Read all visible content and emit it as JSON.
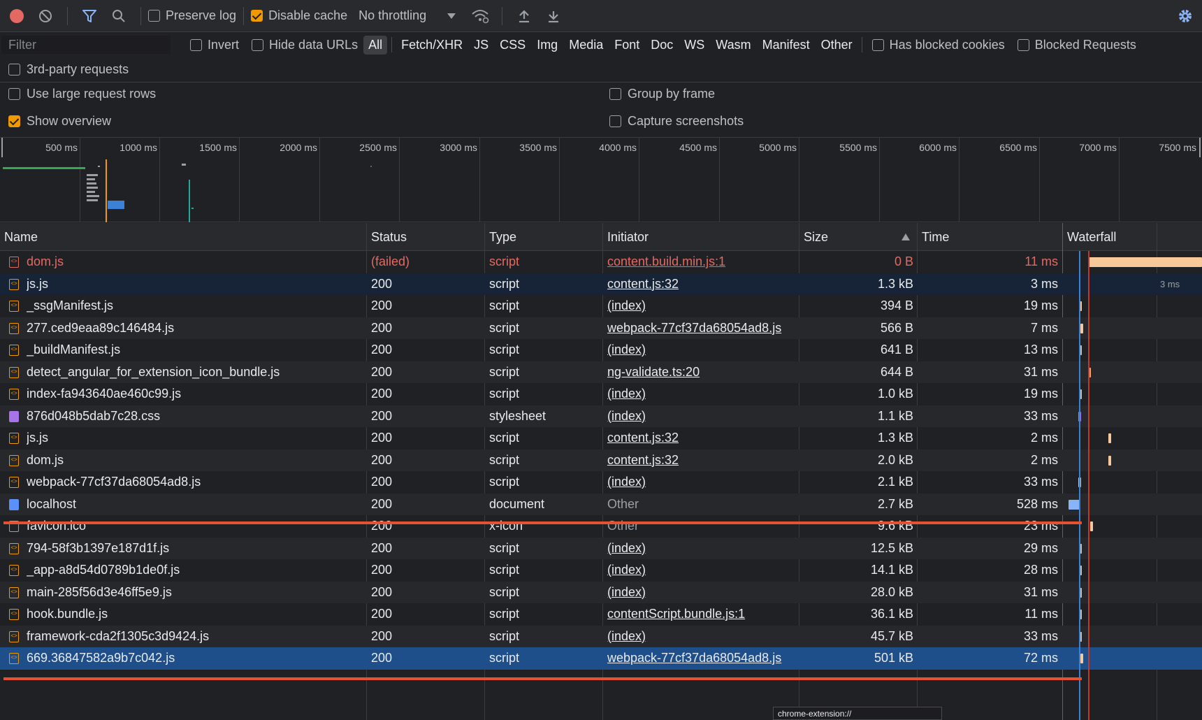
{
  "toolbar": {
    "preserve_log": "Preserve log",
    "disable_cache": "Disable cache",
    "throttling": "No throttling"
  },
  "filterbar": {
    "filter_placeholder": "Filter",
    "invert": "Invert",
    "hide_data_urls": "Hide data URLs",
    "types": [
      "All",
      "Fetch/XHR",
      "JS",
      "CSS",
      "Img",
      "Media",
      "Font",
      "Doc",
      "WS",
      "Wasm",
      "Manifest",
      "Other"
    ],
    "has_blocked_cookies": "Has blocked cookies",
    "blocked_requests": "Blocked Requests",
    "third_party": "3rd-party requests"
  },
  "settings": {
    "large_rows": "Use large request rows",
    "group_by_frame": "Group by frame",
    "show_overview": "Show overview",
    "capture_screenshots": "Capture screenshots"
  },
  "overview": {
    "ticks": [
      "500 ms",
      "1000 ms",
      "1500 ms",
      "2000 ms",
      "2500 ms",
      "3000 ms",
      "3500 ms",
      "4000 ms",
      "4500 ms",
      "5000 ms",
      "5500 ms",
      "6000 ms",
      "6500 ms",
      "7000 ms",
      "7500 ms"
    ]
  },
  "table": {
    "headers": {
      "name": "Name",
      "status": "Status",
      "type": "Type",
      "initiator": "Initiator",
      "size": "Size",
      "time": "Time",
      "waterfall": "Waterfall"
    },
    "rows": [
      {
        "name": "dom.js",
        "status": "(failed)",
        "type": "script",
        "initiator": "content.build.min.js:1",
        "size": "0 B",
        "time": "11 ms"
      },
      {
        "name": "js.js",
        "status": "200",
        "type": "script",
        "initiator": "content.js:32",
        "size": "1.3 kB",
        "time": "3 ms"
      },
      {
        "name": "_ssgManifest.js",
        "status": "200",
        "type": "script",
        "initiator": "(index)",
        "size": "394 B",
        "time": "19 ms"
      },
      {
        "name": "277.ced9eaa89c146484.js",
        "status": "200",
        "type": "script",
        "initiator": "webpack-77cf37da68054ad8.js",
        "size": "566 B",
        "time": "7 ms"
      },
      {
        "name": "_buildManifest.js",
        "status": "200",
        "type": "script",
        "initiator": "(index)",
        "size": "641 B",
        "time": "13 ms"
      },
      {
        "name": "detect_angular_for_extension_icon_bundle.js",
        "status": "200",
        "type": "script",
        "initiator": "ng-validate.ts:20",
        "size": "644 B",
        "time": "31 ms"
      },
      {
        "name": "index-fa943640ae460c99.js",
        "status": "200",
        "type": "script",
        "initiator": "(index)",
        "size": "1.0 kB",
        "time": "19 ms"
      },
      {
        "name": "876d048b5dab7c28.css",
        "status": "200",
        "type": "stylesheet",
        "initiator": "(index)",
        "size": "1.1 kB",
        "time": "33 ms"
      },
      {
        "name": "js.js",
        "status": "200",
        "type": "script",
        "initiator": "content.js:32",
        "size": "1.3 kB",
        "time": "2 ms"
      },
      {
        "name": "dom.js",
        "status": "200",
        "type": "script",
        "initiator": "content.js:32",
        "size": "2.0 kB",
        "time": "2 ms"
      },
      {
        "name": "webpack-77cf37da68054ad8.js",
        "status": "200",
        "type": "script",
        "initiator": "(index)",
        "size": "2.1 kB",
        "time": "33 ms"
      },
      {
        "name": "localhost",
        "status": "200",
        "type": "document",
        "initiator": "Other",
        "size": "2.7 kB",
        "time": "528 ms"
      },
      {
        "name": "favicon.ico",
        "status": "200",
        "type": "x-icon",
        "initiator": "Other",
        "size": "9.6 kB",
        "time": "23 ms"
      },
      {
        "name": "794-58f3b1397e187d1f.js",
        "status": "200",
        "type": "script",
        "initiator": "(index)",
        "size": "12.5 kB",
        "time": "29 ms"
      },
      {
        "name": "_app-a8d54d0789b1de0f.js",
        "status": "200",
        "type": "script",
        "initiator": "(index)",
        "size": "14.1 kB",
        "time": "28 ms"
      },
      {
        "name": "main-285f56d3e46ff5e9.js",
        "status": "200",
        "type": "script",
        "initiator": "(index)",
        "size": "28.0 kB",
        "time": "31 ms"
      },
      {
        "name": "hook.bundle.js",
        "status": "200",
        "type": "script",
        "initiator": "contentScript.bundle.js:1",
        "size": "36.1 kB",
        "time": "11 ms"
      },
      {
        "name": "framework-cda2f1305c3d9424.js",
        "status": "200",
        "type": "script",
        "initiator": "(index)",
        "size": "45.7 kB",
        "time": "33 ms"
      },
      {
        "name": "669.36847582a9b7c042.js",
        "status": "200",
        "type": "script",
        "initiator": "webpack-77cf37da68054ad8.js",
        "size": "501 kB",
        "time": "72 ms"
      }
    ],
    "waterfall_label": "3 ms"
  },
  "tooltip": "chrome-extension://"
}
